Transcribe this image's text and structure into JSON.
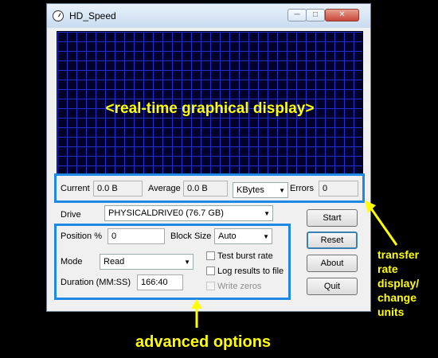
{
  "window": {
    "title": "HD_Speed",
    "caption_buttons": {
      "minimize": "─",
      "maximize": "□",
      "close": "✕"
    }
  },
  "graph": {
    "placeholder": "<real-time graphical display>"
  },
  "status": {
    "current_label": "Current",
    "current_value": "0.0 B",
    "average_label": "Average",
    "average_value": "0.0 B",
    "units_value": "KBytes",
    "errors_label": "Errors",
    "errors_value": "0"
  },
  "drive": {
    "label": "Drive",
    "value": "PHYSICALDRIVE0 (76.7 GB)"
  },
  "options": {
    "position_label": "Position %",
    "position_value": "0",
    "block_size_label": "Block Size",
    "block_size_value": "Auto",
    "mode_label": "Mode",
    "mode_value": "Read",
    "duration_label": "Duration (MM:SS)",
    "duration_value": "166:40",
    "test_burst_rate": {
      "label": "Test burst rate",
      "checked": false
    },
    "log_results": {
      "label": "Log results to file",
      "checked": false
    },
    "write_zeros": {
      "label": "Write zeros",
      "checked": false,
      "enabled": false
    }
  },
  "buttons": {
    "start": "Start",
    "reset": "Reset",
    "about": "About",
    "quit": "Quit"
  },
  "annotations": {
    "advanced": "advanced options",
    "transfer_lines": [
      "transfer",
      "rate",
      "display/",
      "change",
      "units"
    ],
    "highlight_color": "#1e88e5",
    "text_color": "#ffff00"
  }
}
